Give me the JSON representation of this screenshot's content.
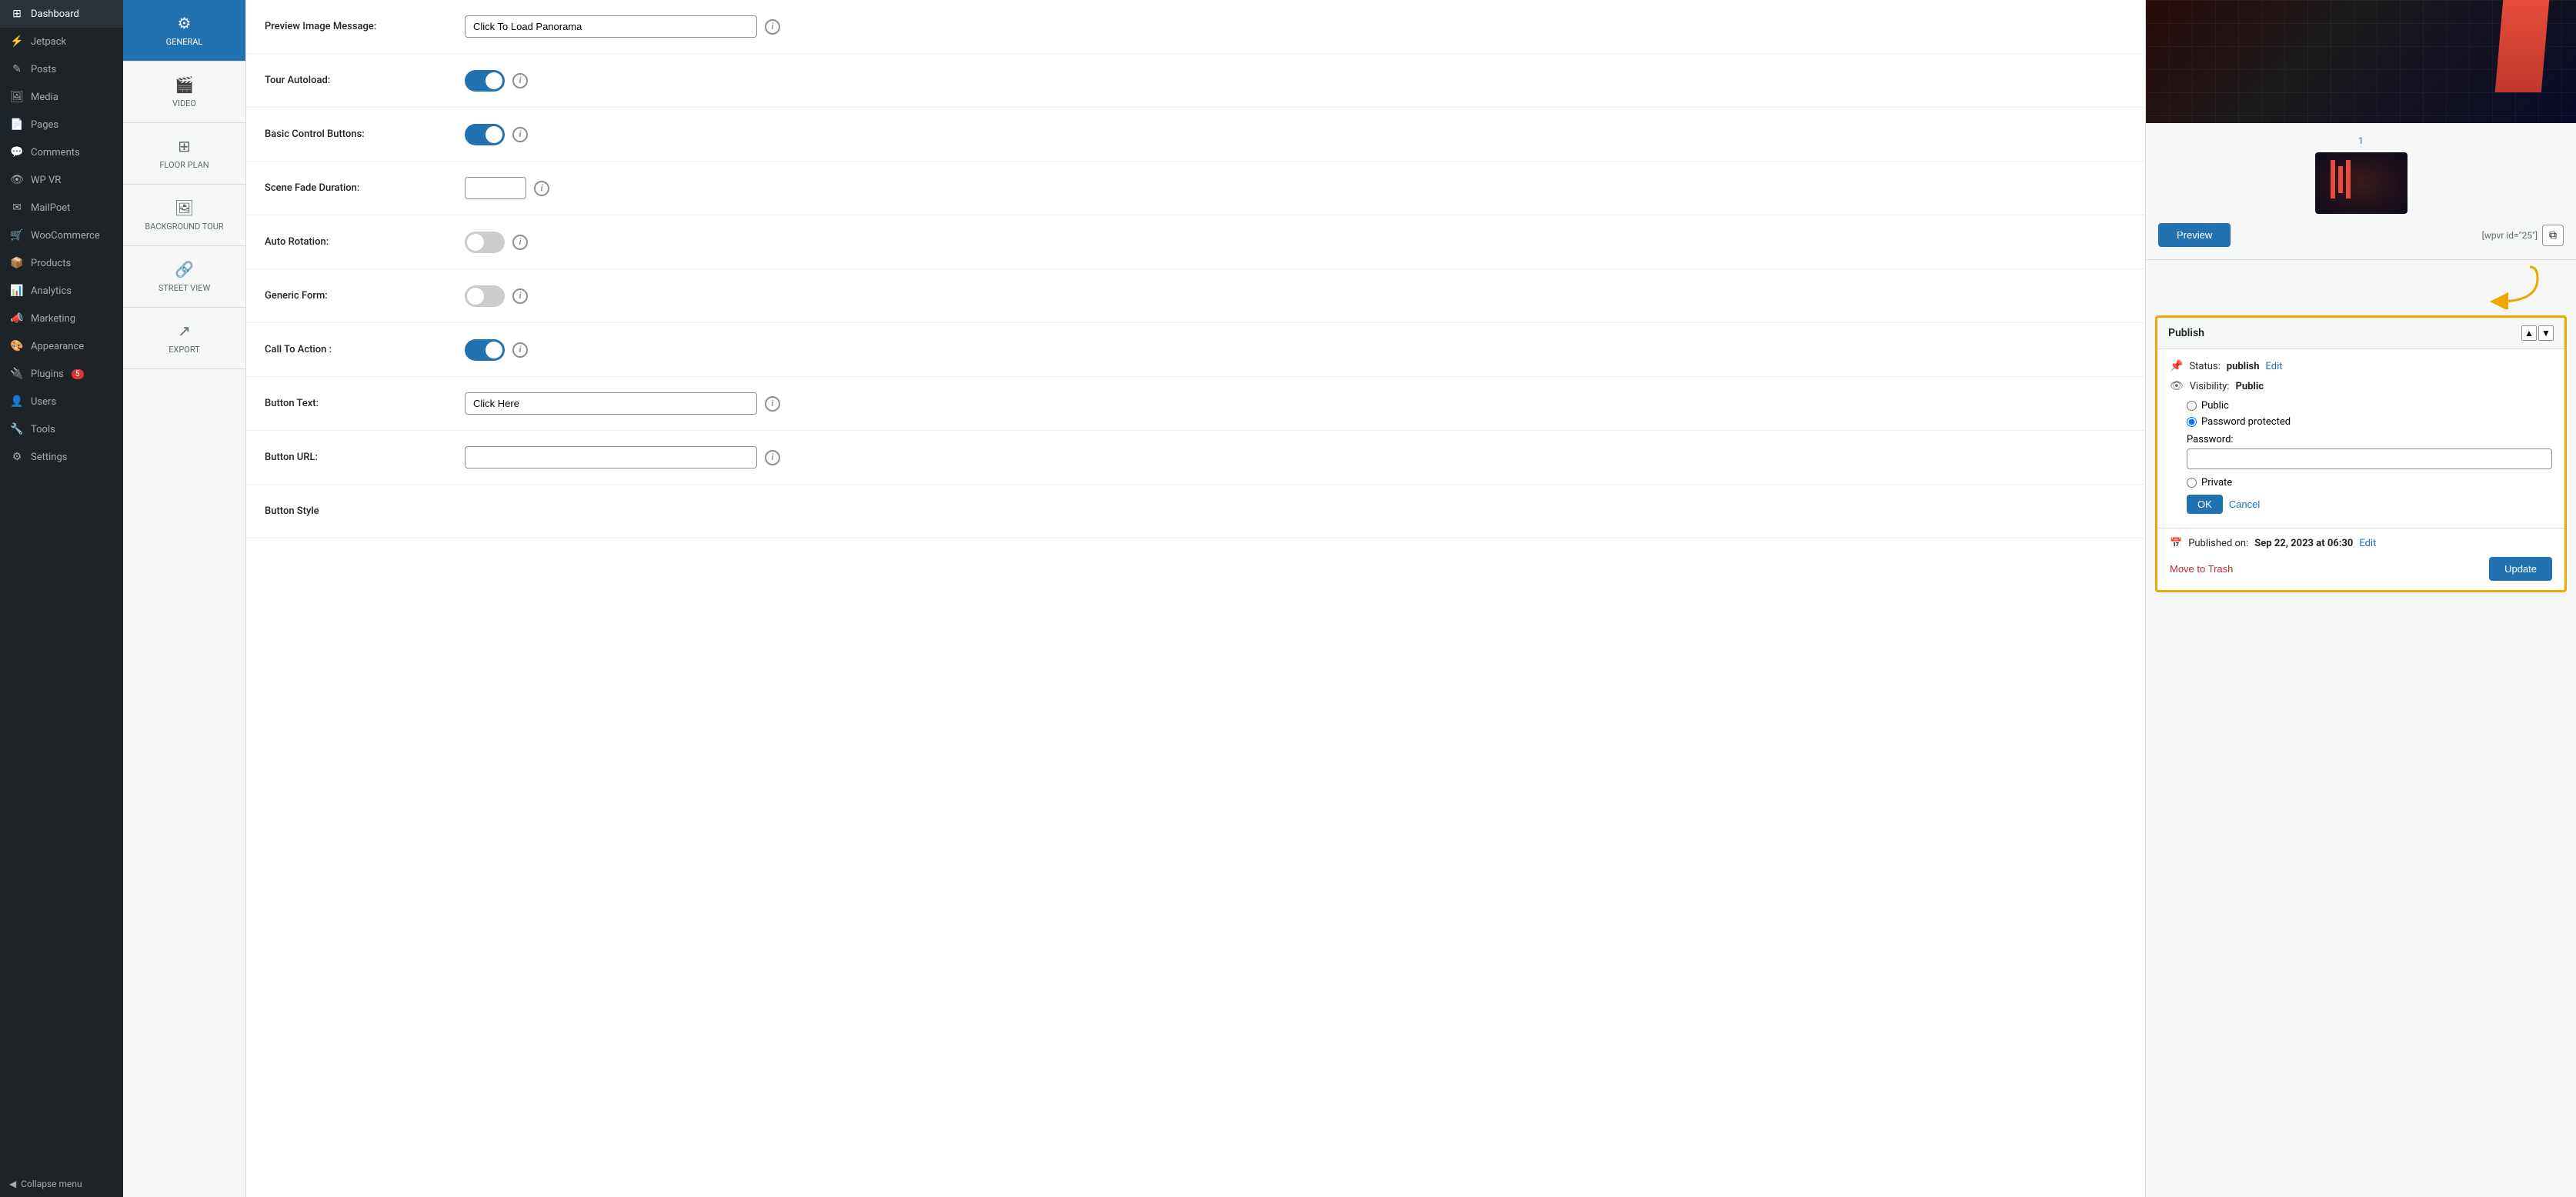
{
  "sidebar": {
    "items": [
      {
        "id": "dashboard",
        "label": "Dashboard",
        "icon": "⊞"
      },
      {
        "id": "jetpack",
        "label": "Jetpack",
        "icon": "⚡"
      },
      {
        "id": "posts",
        "label": "Posts",
        "icon": "✎"
      },
      {
        "id": "media",
        "label": "Media",
        "icon": "🖼"
      },
      {
        "id": "pages",
        "label": "Pages",
        "icon": "📄"
      },
      {
        "id": "comments",
        "label": "Comments",
        "icon": "💬"
      },
      {
        "id": "wp-vr",
        "label": "WP VR",
        "icon": "👁"
      },
      {
        "id": "mailpoet",
        "label": "MailPoet",
        "icon": "✉"
      },
      {
        "id": "woocommerce",
        "label": "WooCommerce",
        "icon": "🛒"
      },
      {
        "id": "products",
        "label": "Products",
        "icon": "📦"
      },
      {
        "id": "analytics",
        "label": "Analytics",
        "icon": "📊"
      },
      {
        "id": "marketing",
        "label": "Marketing",
        "icon": "📣"
      },
      {
        "id": "appearance",
        "label": "Appearance",
        "icon": "🎨"
      },
      {
        "id": "plugins",
        "label": "Plugins",
        "icon": "🔌",
        "badge": "5"
      },
      {
        "id": "users",
        "label": "Users",
        "icon": "👤"
      },
      {
        "id": "tools",
        "label": "Tools",
        "icon": "🔧"
      },
      {
        "id": "settings",
        "label": "Settings",
        "icon": "⚙"
      }
    ],
    "collapse_label": "Collapse menu"
  },
  "left_panel": {
    "items": [
      {
        "id": "general",
        "label": "GENERAL",
        "icon": "⚙",
        "active": true
      },
      {
        "id": "video",
        "label": "VIDEO",
        "icon": "🎬"
      },
      {
        "id": "floor_plan",
        "label": "FLOOR PLAN",
        "icon": "⊞"
      },
      {
        "id": "background_tour",
        "label": "BACKGROUND TOUR",
        "icon": "🖼"
      },
      {
        "id": "street_view",
        "label": "STREET VIEW",
        "icon": "🔗"
      },
      {
        "id": "export",
        "label": "EXPORT",
        "icon": "↗"
      }
    ]
  },
  "form": {
    "fields": [
      {
        "id": "preview_image_message",
        "label": "Preview Image Message:",
        "type": "text",
        "value": "Click To Load Panorama"
      },
      {
        "id": "tour_autoload",
        "label": "Tour Autoload:",
        "type": "toggle",
        "value": true
      },
      {
        "id": "basic_control_buttons",
        "label": "Basic Control Buttons:",
        "type": "toggle",
        "value": true
      },
      {
        "id": "scene_fade_duration",
        "label": "Scene Fade Duration:",
        "type": "text_small",
        "value": ""
      },
      {
        "id": "auto_rotation",
        "label": "Auto Rotation:",
        "type": "toggle",
        "value": false
      },
      {
        "id": "generic_form",
        "label": "Generic Form:",
        "type": "toggle",
        "value": false
      },
      {
        "id": "call_to_action",
        "label": "Call To Action :",
        "type": "toggle",
        "value": true
      },
      {
        "id": "button_text",
        "label": "Button Text:",
        "type": "text",
        "value": "Click Here"
      },
      {
        "id": "button_url",
        "label": "Button URL:",
        "type": "text",
        "value": ""
      },
      {
        "id": "button_style",
        "label": "Button Style",
        "type": "section_header",
        "value": ""
      }
    ]
  },
  "right_panel": {
    "scene_number": "1",
    "preview_btn_label": "Preview",
    "shortcode": "[wpvr id=\"25\"]",
    "publish": {
      "title": "Publish",
      "status_label": "Status:",
      "status_value": "publish",
      "status_edit": "Edit",
      "visibility_label": "Visibility:",
      "visibility_value": "Public",
      "radio_public": "Public",
      "radio_password": "Password protected",
      "radio_private": "Private",
      "password_label": "Password:",
      "ok_label": "OK",
      "cancel_label": "Cancel",
      "published_on_label": "Published on:",
      "published_date": "Sep 22, 2023 at 06:30",
      "published_edit": "Edit",
      "move_trash_label": "Move to Trash",
      "update_label": "Update"
    }
  }
}
